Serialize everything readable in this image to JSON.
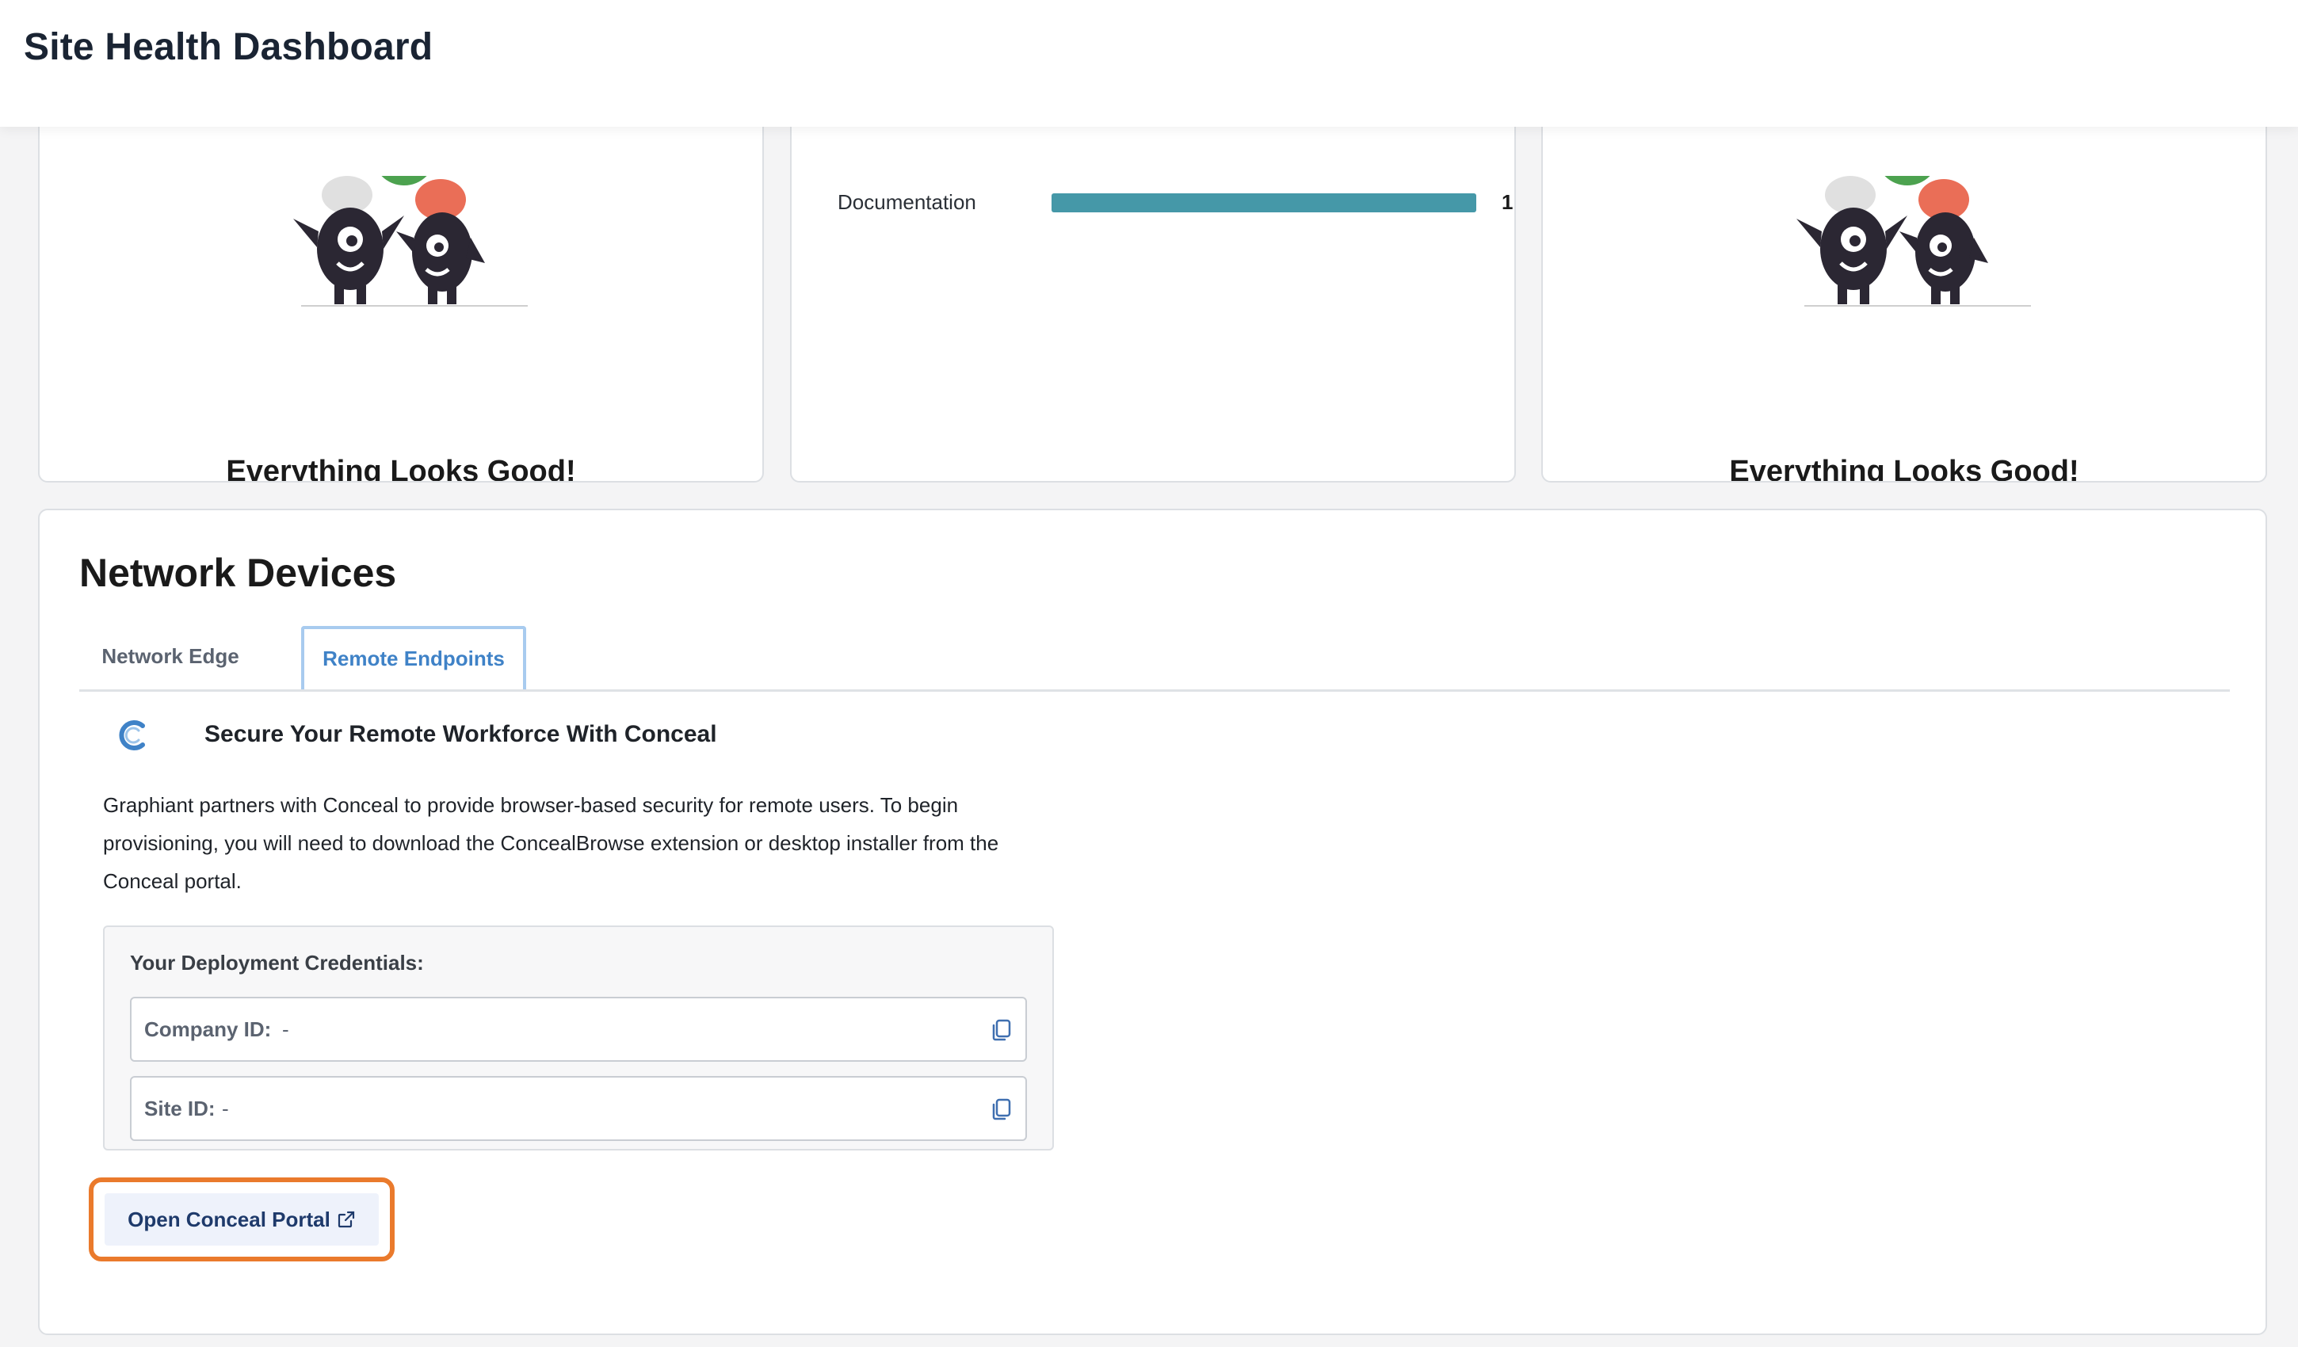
{
  "header": {
    "title": "Site Health Dashboard"
  },
  "cards": {
    "left": {
      "status_text": "Everything Looks Good!"
    },
    "middle": {
      "bar": {
        "label": "Documentation",
        "value": "1",
        "fill_fraction": 1.0,
        "color": "#4598a8"
      }
    },
    "right": {
      "status_text": "Everything Looks Good!"
    }
  },
  "network": {
    "title": "Network Devices",
    "tabs": [
      {
        "label": "Network Edge",
        "active": false
      },
      {
        "label": "Remote Endpoints",
        "active": true
      }
    ],
    "conceal": {
      "title": "Secure Your Remote Workforce With Conceal",
      "description": "Graphiant partners with Conceal to provide browser-based security for remote users. To begin provisioning, you will need to download the ConcealBrowse extension or desktop installer from the Conceal portal.",
      "credentials_label": "Your Deployment Credentials:",
      "company_id_label": "Company ID:",
      "company_id_value": "-",
      "site_id_label": "Site ID:",
      "site_id_value": "-",
      "open_button": "Open Conceal Portal"
    }
  },
  "colors": {
    "accent_blue": "#3f82c7",
    "highlight_orange": "#ea7a2c",
    "bar_teal": "#4598a8"
  },
  "icons": [
    "conceal-logo-icon",
    "copy-icon",
    "external-link-icon"
  ]
}
